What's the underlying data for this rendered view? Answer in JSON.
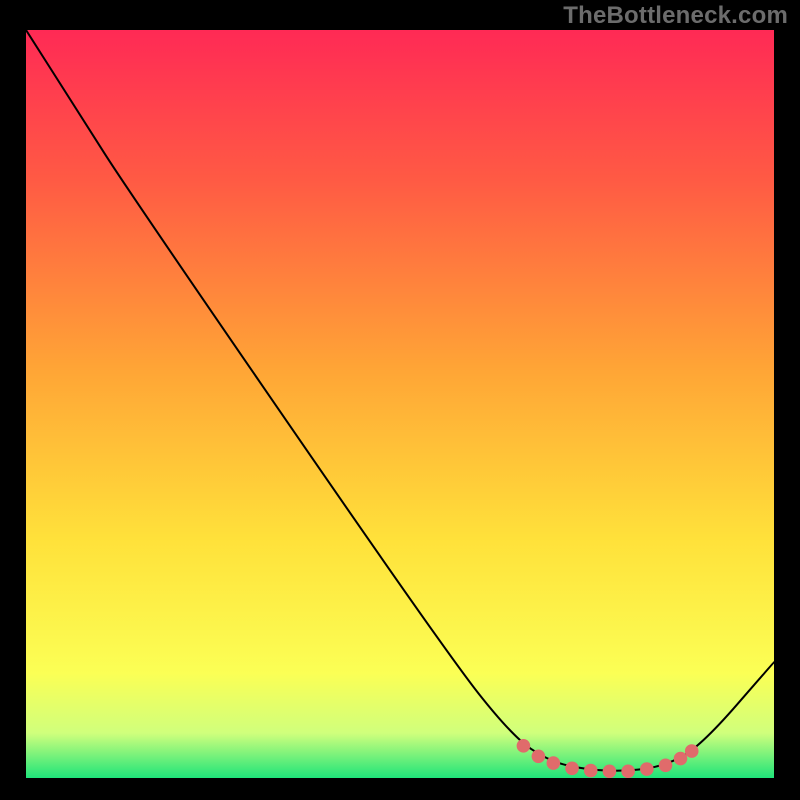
{
  "attribution": "TheBottleneck.com",
  "chart_data": {
    "type": "line",
    "title": "",
    "xlabel": "",
    "ylabel": "",
    "xlim": [
      0,
      100
    ],
    "ylim": [
      0,
      100
    ],
    "gradient_stops": [
      {
        "offset": 0,
        "color": "#ff2a55"
      },
      {
        "offset": 20,
        "color": "#ff5a44"
      },
      {
        "offset": 45,
        "color": "#ffa436"
      },
      {
        "offset": 68,
        "color": "#ffe13a"
      },
      {
        "offset": 86,
        "color": "#fbff55"
      },
      {
        "offset": 94,
        "color": "#d0ff7c"
      },
      {
        "offset": 100,
        "color": "#1fe47a"
      }
    ],
    "series": [
      {
        "name": "curve",
        "color": "#000000",
        "points": [
          {
            "x": 0.0,
            "y": 100.0
          },
          {
            "x": 7.0,
            "y": 89.0
          },
          {
            "x": 14.0,
            "y": 78.0
          },
          {
            "x": 56.0,
            "y": 17.0
          },
          {
            "x": 65.0,
            "y": 5.6
          },
          {
            "x": 70.0,
            "y": 2.2
          },
          {
            "x": 75.0,
            "y": 1.1
          },
          {
            "x": 80.0,
            "y": 0.9
          },
          {
            "x": 85.0,
            "y": 1.5
          },
          {
            "x": 90.0,
            "y": 4.0
          },
          {
            "x": 100.0,
            "y": 15.5
          }
        ]
      },
      {
        "name": "highlight",
        "color": "#e06b6b",
        "style": "dotted-thick",
        "points": [
          {
            "x": 66.5,
            "y": 4.3
          },
          {
            "x": 68.5,
            "y": 2.9
          },
          {
            "x": 70.5,
            "y": 2.0
          },
          {
            "x": 73.0,
            "y": 1.3
          },
          {
            "x": 75.5,
            "y": 1.0
          },
          {
            "x": 78.0,
            "y": 0.9
          },
          {
            "x": 80.5,
            "y": 0.9
          },
          {
            "x": 83.0,
            "y": 1.2
          },
          {
            "x": 85.5,
            "y": 1.7
          },
          {
            "x": 87.5,
            "y": 2.6
          },
          {
            "x": 89.0,
            "y": 3.6
          }
        ]
      }
    ]
  }
}
